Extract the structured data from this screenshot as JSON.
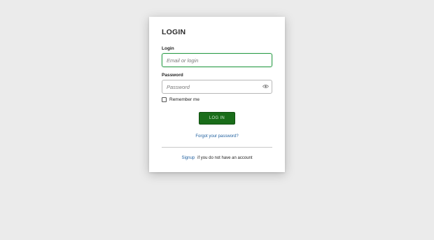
{
  "form": {
    "title": "LOGIN",
    "login_label": "Login",
    "login_placeholder": "Email or login",
    "password_label": "Password",
    "password_placeholder": "Password",
    "remember_label": "Remember me",
    "submit_label": "LOG IN",
    "forgot_link": "Forgot your password?",
    "signup_link": "Signup",
    "signup_text": "if you do not have an account"
  },
  "icons": {
    "password_toggle": "eye-icon"
  },
  "colors": {
    "accent_button": "#1a6d1a",
    "focus_border": "#2e9e4a",
    "link": "#1f5f9e"
  }
}
